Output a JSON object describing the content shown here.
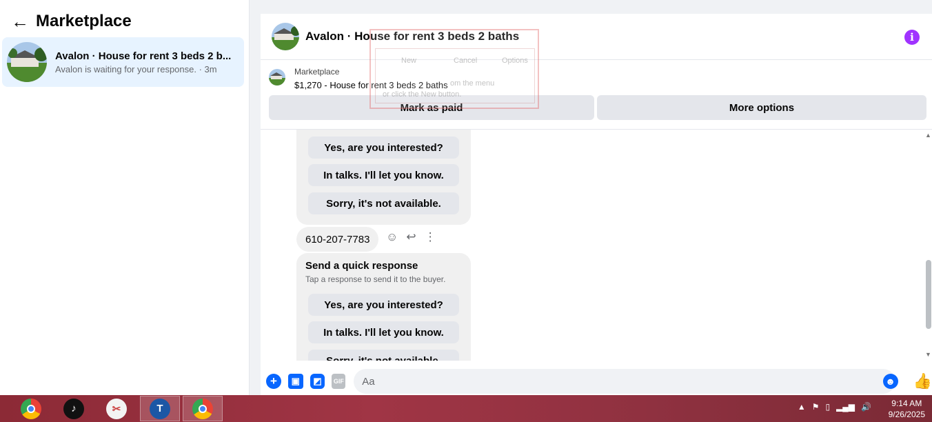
{
  "sidebar": {
    "back_glyph": "←",
    "title": "Marketplace",
    "conversation": {
      "title": "Avalon · House for rent 3 beds 2 b...",
      "subtitle": "Avalon is waiting for your response. · 3m"
    }
  },
  "chat": {
    "title": "Avalon · House for rent 3 beds 2 baths",
    "info_icon": "info-icon",
    "listing": {
      "category": "Marketplace",
      "name": "$1,270 - House for rent 3 beds 2 baths",
      "mark_paid_label": "Mark as paid",
      "more_options_label": "More options"
    },
    "ghost_window": {
      "new": "New",
      "cancel": "Cancel",
      "options": "Options",
      "line1": "om the menu",
      "line2": "or click the New button."
    },
    "messages": {
      "group1_responses": [
        "Yes, are you interested?",
        "In talks. I'll let you know.",
        "Sorry, it's not available."
      ],
      "phone": "610-207-7783",
      "group2_title": "Send a quick response",
      "group2_subtitle": "Tap a response to send it to the buyer.",
      "group2_responses": [
        "Yes, are you interested?",
        "In talks. I'll let you know.",
        "Sorry, it's not available."
      ]
    },
    "composer": {
      "placeholder": "Aa",
      "gif_label": "GIF"
    }
  },
  "taskbar": {
    "apps": [
      "chrome-icon",
      "tiktok-icon",
      "snipping-tool-icon",
      "t-app-icon",
      "chrome-profile-icon"
    ],
    "time": "9:14 AM",
    "date": "9/26/2025"
  },
  "colors": {
    "accent": "#0866ff",
    "info": "#a033ff",
    "taskbar": "#9a3242"
  }
}
